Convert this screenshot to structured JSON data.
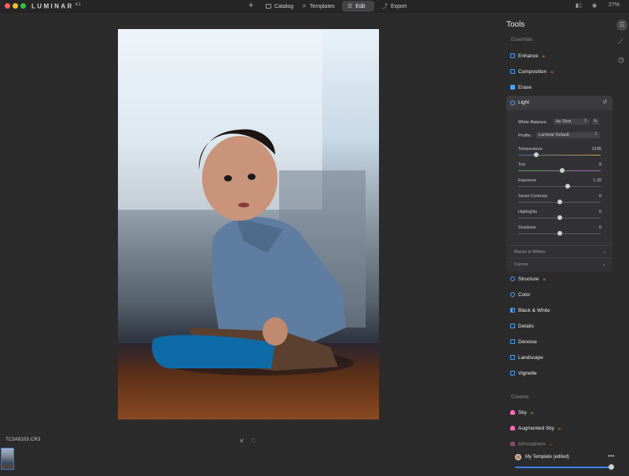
{
  "app": {
    "logo": "LUMINAR",
    "version": "4.1"
  },
  "topbar": {
    "catalog": "Catalog",
    "templates": "Templates",
    "edit": "Edit",
    "export": "Export",
    "zoom": "27%"
  },
  "filmstrip": {
    "filename": "7C3A8103.CR3"
  },
  "tools": {
    "title": "Tools",
    "essentials_label": "Essentials",
    "items_top": [
      {
        "label": "Enhance",
        "badge": "AI"
      },
      {
        "label": "Composition",
        "badge": "AI"
      },
      {
        "label": "Erase",
        "badge": ""
      },
      {
        "label": "Light",
        "badge": ""
      }
    ],
    "light": {
      "white_balance_label": "White Balance:",
      "white_balance_value": "As Shot",
      "profile_label": "Profile:",
      "profile_value": "Luminar Default",
      "sliders": [
        {
          "label": "Temperature",
          "value": "3195",
          "pos": 0.22
        },
        {
          "label": "Tint",
          "value": "8",
          "pos": 0.53
        },
        {
          "label": "Exposure",
          "value": "1.20",
          "pos": 0.6
        },
        {
          "label": "Smart Contrast",
          "value": "0",
          "pos": 0.5
        },
        {
          "label": "Highlights",
          "value": "0",
          "pos": 0.5
        },
        {
          "label": "Shadows",
          "value": "0",
          "pos": 0.5
        }
      ],
      "sub_blacks": "Blacks & Whites",
      "sub_curves": "Curves"
    },
    "items_bottom": [
      {
        "label": "Structure",
        "badge": "AI"
      },
      {
        "label": "Color",
        "badge": ""
      },
      {
        "label": "Black & White",
        "badge": ""
      },
      {
        "label": "Details",
        "badge": ""
      },
      {
        "label": "Denoise",
        "badge": ""
      },
      {
        "label": "Landscape",
        "badge": ""
      },
      {
        "label": "Vignette",
        "badge": ""
      }
    ],
    "creative_label": "Creative",
    "items_creative": [
      {
        "label": "Sky",
        "badge": "AI"
      },
      {
        "label": "Augmented Sky",
        "badge": "AI"
      },
      {
        "label": "Atmosphere",
        "badge": "AI"
      }
    ]
  },
  "template": {
    "name": "My Template (edited)"
  },
  "colors": {
    "accent": "#4aa3ff",
    "ai_badge": "#ff9a3d",
    "sky_icon": "#ff6fb5"
  }
}
